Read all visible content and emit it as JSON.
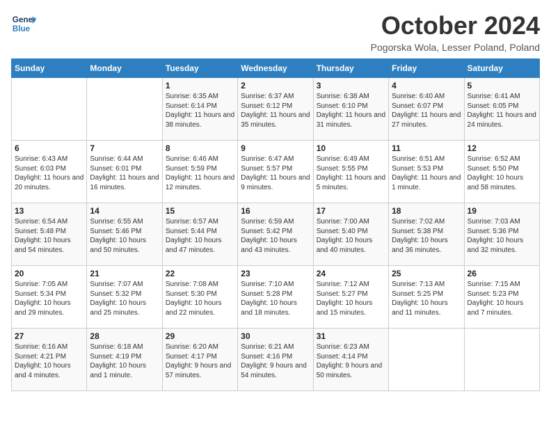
{
  "header": {
    "logo_line1": "General",
    "logo_line2": "Blue",
    "month": "October 2024",
    "location": "Pogorska Wola, Lesser Poland, Poland"
  },
  "days_of_week": [
    "Sunday",
    "Monday",
    "Tuesday",
    "Wednesday",
    "Thursday",
    "Friday",
    "Saturday"
  ],
  "weeks": [
    [
      {
        "day": "",
        "info": ""
      },
      {
        "day": "",
        "info": ""
      },
      {
        "day": "1",
        "info": "Sunrise: 6:35 AM\nSunset: 6:14 PM\nDaylight: 11 hours and 38 minutes."
      },
      {
        "day": "2",
        "info": "Sunrise: 6:37 AM\nSunset: 6:12 PM\nDaylight: 11 hours and 35 minutes."
      },
      {
        "day": "3",
        "info": "Sunrise: 6:38 AM\nSunset: 6:10 PM\nDaylight: 11 hours and 31 minutes."
      },
      {
        "day": "4",
        "info": "Sunrise: 6:40 AM\nSunset: 6:07 PM\nDaylight: 11 hours and 27 minutes."
      },
      {
        "day": "5",
        "info": "Sunrise: 6:41 AM\nSunset: 6:05 PM\nDaylight: 11 hours and 24 minutes."
      }
    ],
    [
      {
        "day": "6",
        "info": "Sunrise: 6:43 AM\nSunset: 6:03 PM\nDaylight: 11 hours and 20 minutes."
      },
      {
        "day": "7",
        "info": "Sunrise: 6:44 AM\nSunset: 6:01 PM\nDaylight: 11 hours and 16 minutes."
      },
      {
        "day": "8",
        "info": "Sunrise: 6:46 AM\nSunset: 5:59 PM\nDaylight: 11 hours and 12 minutes."
      },
      {
        "day": "9",
        "info": "Sunrise: 6:47 AM\nSunset: 5:57 PM\nDaylight: 11 hours and 9 minutes."
      },
      {
        "day": "10",
        "info": "Sunrise: 6:49 AM\nSunset: 5:55 PM\nDaylight: 11 hours and 5 minutes."
      },
      {
        "day": "11",
        "info": "Sunrise: 6:51 AM\nSunset: 5:53 PM\nDaylight: 11 hours and 1 minute."
      },
      {
        "day": "12",
        "info": "Sunrise: 6:52 AM\nSunset: 5:50 PM\nDaylight: 10 hours and 58 minutes."
      }
    ],
    [
      {
        "day": "13",
        "info": "Sunrise: 6:54 AM\nSunset: 5:48 PM\nDaylight: 10 hours and 54 minutes."
      },
      {
        "day": "14",
        "info": "Sunrise: 6:55 AM\nSunset: 5:46 PM\nDaylight: 10 hours and 50 minutes."
      },
      {
        "day": "15",
        "info": "Sunrise: 6:57 AM\nSunset: 5:44 PM\nDaylight: 10 hours and 47 minutes."
      },
      {
        "day": "16",
        "info": "Sunrise: 6:59 AM\nSunset: 5:42 PM\nDaylight: 10 hours and 43 minutes."
      },
      {
        "day": "17",
        "info": "Sunrise: 7:00 AM\nSunset: 5:40 PM\nDaylight: 10 hours and 40 minutes."
      },
      {
        "day": "18",
        "info": "Sunrise: 7:02 AM\nSunset: 5:38 PM\nDaylight: 10 hours and 36 minutes."
      },
      {
        "day": "19",
        "info": "Sunrise: 7:03 AM\nSunset: 5:36 PM\nDaylight: 10 hours and 32 minutes."
      }
    ],
    [
      {
        "day": "20",
        "info": "Sunrise: 7:05 AM\nSunset: 5:34 PM\nDaylight: 10 hours and 29 minutes."
      },
      {
        "day": "21",
        "info": "Sunrise: 7:07 AM\nSunset: 5:32 PM\nDaylight: 10 hours and 25 minutes."
      },
      {
        "day": "22",
        "info": "Sunrise: 7:08 AM\nSunset: 5:30 PM\nDaylight: 10 hours and 22 minutes."
      },
      {
        "day": "23",
        "info": "Sunrise: 7:10 AM\nSunset: 5:28 PM\nDaylight: 10 hours and 18 minutes."
      },
      {
        "day": "24",
        "info": "Sunrise: 7:12 AM\nSunset: 5:27 PM\nDaylight: 10 hours and 15 minutes."
      },
      {
        "day": "25",
        "info": "Sunrise: 7:13 AM\nSunset: 5:25 PM\nDaylight: 10 hours and 11 minutes."
      },
      {
        "day": "26",
        "info": "Sunrise: 7:15 AM\nSunset: 5:23 PM\nDaylight: 10 hours and 7 minutes."
      }
    ],
    [
      {
        "day": "27",
        "info": "Sunrise: 6:16 AM\nSunset: 4:21 PM\nDaylight: 10 hours and 4 minutes."
      },
      {
        "day": "28",
        "info": "Sunrise: 6:18 AM\nSunset: 4:19 PM\nDaylight: 10 hours and 1 minute."
      },
      {
        "day": "29",
        "info": "Sunrise: 6:20 AM\nSunset: 4:17 PM\nDaylight: 9 hours and 57 minutes."
      },
      {
        "day": "30",
        "info": "Sunrise: 6:21 AM\nSunset: 4:16 PM\nDaylight: 9 hours and 54 minutes."
      },
      {
        "day": "31",
        "info": "Sunrise: 6:23 AM\nSunset: 4:14 PM\nDaylight: 9 hours and 50 minutes."
      },
      {
        "day": "",
        "info": ""
      },
      {
        "day": "",
        "info": ""
      }
    ]
  ]
}
